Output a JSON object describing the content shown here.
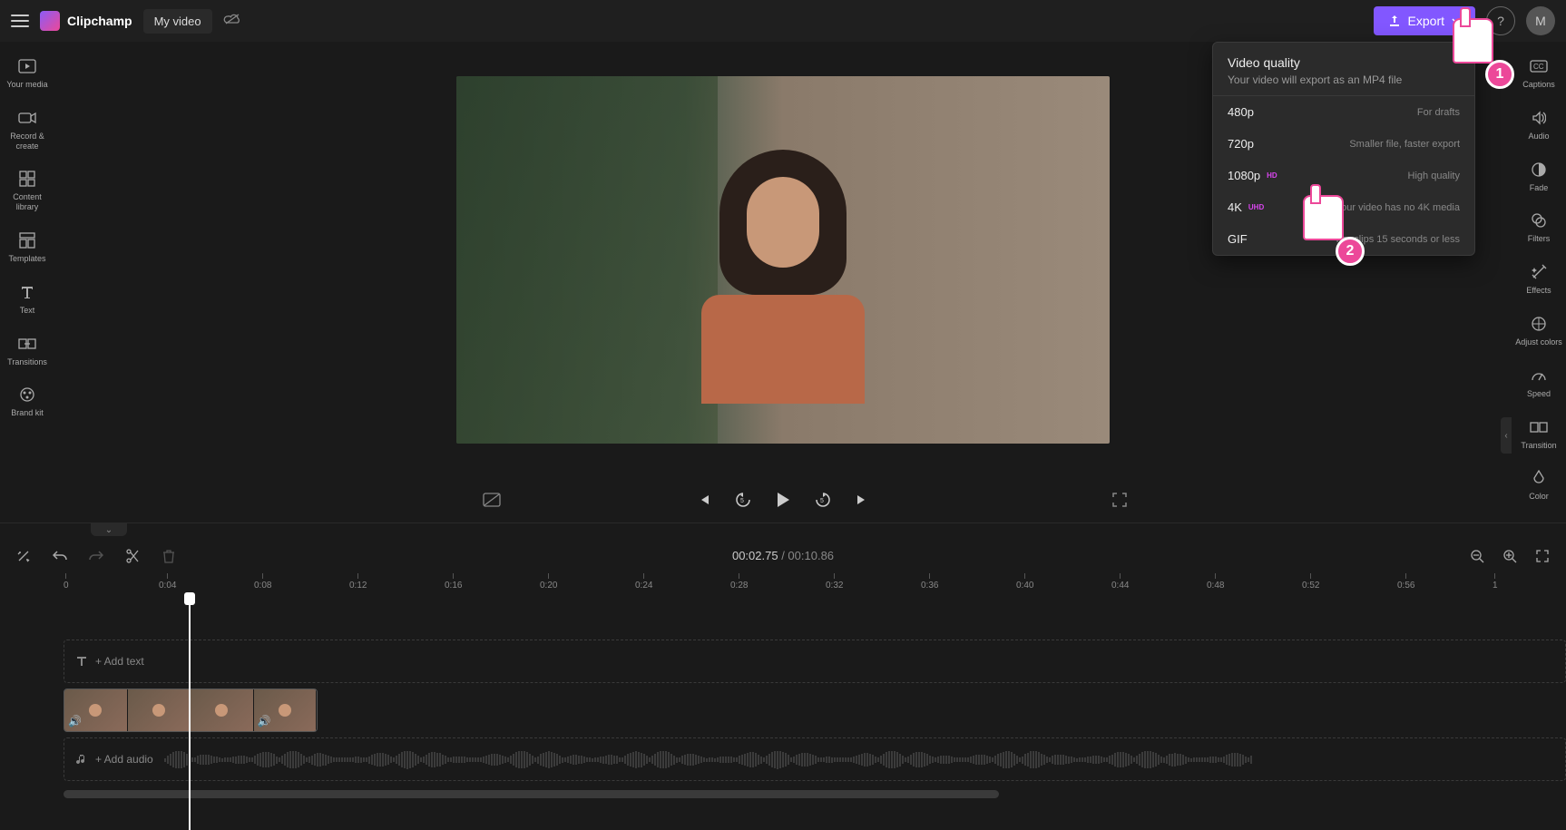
{
  "app": {
    "name": "Clipchamp"
  },
  "video": {
    "title": "My video"
  },
  "topbar": {
    "export_label": "Export",
    "help_glyph": "?",
    "avatar_initial": "M"
  },
  "left_sidebar": [
    {
      "id": "your-media",
      "label": "Your media"
    },
    {
      "id": "record-create",
      "label": "Record & create"
    },
    {
      "id": "content-library",
      "label": "Content library"
    },
    {
      "id": "templates",
      "label": "Templates"
    },
    {
      "id": "text",
      "label": "Text"
    },
    {
      "id": "transitions",
      "label": "Transitions"
    },
    {
      "id": "brand-kit",
      "label": "Brand kit"
    }
  ],
  "right_sidebar": [
    {
      "id": "captions",
      "label": "Captions"
    },
    {
      "id": "audio",
      "label": "Audio"
    },
    {
      "id": "fade",
      "label": "Fade"
    },
    {
      "id": "filters",
      "label": "Filters"
    },
    {
      "id": "effects",
      "label": "Effects"
    },
    {
      "id": "adjust-colors",
      "label": "Adjust colors"
    },
    {
      "id": "speed",
      "label": "Speed"
    },
    {
      "id": "transition",
      "label": "Transition"
    },
    {
      "id": "color",
      "label": "Color"
    }
  ],
  "export_menu": {
    "title": "Video quality",
    "subtitle": "Your video will export as an MP4 file",
    "options": [
      {
        "name": "480p",
        "badge": "",
        "desc": "For drafts"
      },
      {
        "name": "720p",
        "badge": "",
        "desc": "Smaller file, faster export"
      },
      {
        "name": "1080p",
        "badge": "HD",
        "desc": "High quality"
      },
      {
        "name": "4K",
        "badge": "UHD",
        "desc": "Your video has no 4K media"
      },
      {
        "name": "GIF",
        "badge": "",
        "desc": "For clips 15 seconds or less"
      }
    ]
  },
  "cursors": {
    "one": "1",
    "two": "2"
  },
  "playback": {
    "current": "00:02.75",
    "separator": " / ",
    "duration": "00:10.86"
  },
  "timeline": {
    "add_text": "+ Add text",
    "add_audio": "+ Add audio",
    "ruler": [
      "0",
      "0:04",
      "0:08",
      "0:12",
      "0:16",
      "0:20",
      "0:24",
      "0:28",
      "0:32",
      "0:36",
      "0:40",
      "0:44",
      "0:48",
      "0:52",
      "0:56",
      "1"
    ]
  }
}
